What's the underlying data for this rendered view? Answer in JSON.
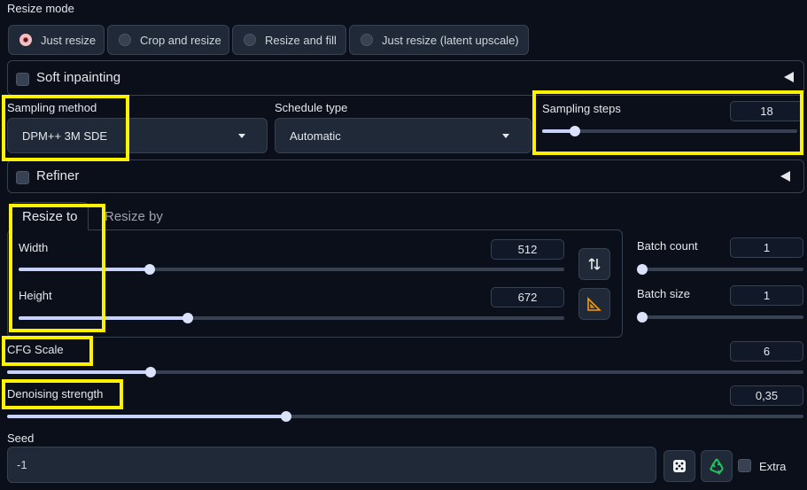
{
  "resize_mode": {
    "label": "Resize mode",
    "options": [
      {
        "label": "Just resize",
        "selected": true
      },
      {
        "label": "Crop and resize",
        "selected": false
      },
      {
        "label": "Resize and fill",
        "selected": false
      },
      {
        "label": "Just resize (latent upscale)",
        "selected": false
      }
    ]
  },
  "soft_inpainting": {
    "label": "Soft inpainting",
    "checked": false
  },
  "sampling_method": {
    "label": "Sampling method",
    "value": "DPM++ 3M SDE"
  },
  "schedule_type": {
    "label": "Schedule type",
    "value": "Automatic"
  },
  "sampling_steps": {
    "label": "Sampling steps",
    "value": "18",
    "fraction": 0.13
  },
  "refiner": {
    "label": "Refiner",
    "checked": false
  },
  "tabs": {
    "resize_to": "Resize to",
    "resize_by": "Resize by",
    "active": "resize_to"
  },
  "width": {
    "label": "Width",
    "value": "512",
    "fraction": 0.24
  },
  "height": {
    "label": "Height",
    "value": "672",
    "fraction": 0.31
  },
  "batch_count": {
    "label": "Batch count",
    "value": "1",
    "fraction": 0.0
  },
  "batch_size": {
    "label": "Batch size",
    "value": "1",
    "fraction": 0.0
  },
  "cfg_scale": {
    "label": "CFG Scale",
    "value": "6",
    "fraction": 0.18
  },
  "denoising_strength": {
    "label": "Denoising strength",
    "value": "0,35",
    "fraction": 0.35
  },
  "seed": {
    "label": "Seed",
    "value": "-1"
  },
  "extra": {
    "label": "Extra",
    "checked": false
  },
  "icons": {
    "swap": "swap-dimensions-icon",
    "aspect": "aspect-ratio-icon",
    "dice": "random-dice-icon",
    "recycle": "reuse-seed-icon",
    "collapse": "collapse-triangle-icon"
  },
  "colors": {
    "highlight": "#fef200",
    "slider_fill": "#c7d2fe",
    "background": "#0b0f19"
  }
}
